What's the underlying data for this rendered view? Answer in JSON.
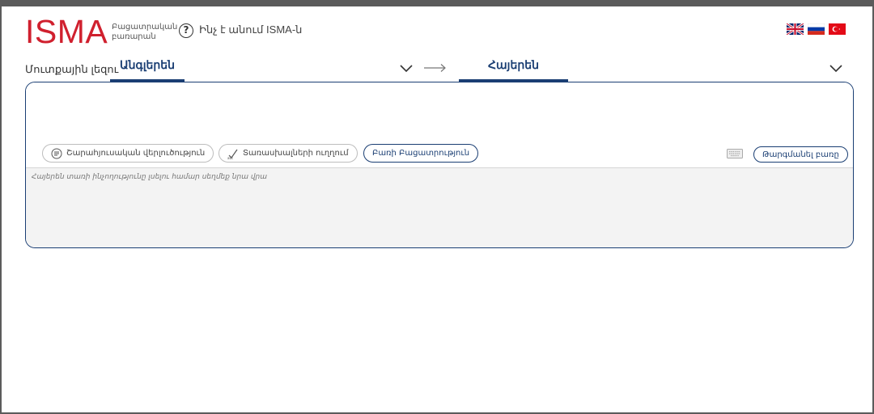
{
  "header": {
    "logo": "ISMA",
    "tagline_line1": "Բացատրական",
    "tagline_line2": "բառարան",
    "help_icon_glyph": "?",
    "help_link": "Ինչ է անում ISMA-ն",
    "flags": [
      "uk-flag-icon",
      "russia-flag-icon",
      "turkey-flag-icon"
    ]
  },
  "languages": {
    "source_label": "Մուտքային լեզու",
    "source": "Անգլերեն",
    "target": "Հայերեն"
  },
  "input": {
    "value": "",
    "buttons": {
      "grammar": "Շարահյուսական վերլուծություն",
      "spellcheck": "Տառասխալների ուղղում",
      "explanation": "Բառի Բացատրություն",
      "translate": "Թարգմանել բառը"
    }
  },
  "output": {
    "hint": "Հայերեն տառի ինչողությունը լսելու համար սեղմեք նրա վրա"
  },
  "colors": {
    "brand_red": "#d0202e",
    "accent_blue": "#1a3e73",
    "output_bg": "#f3f3f3"
  }
}
